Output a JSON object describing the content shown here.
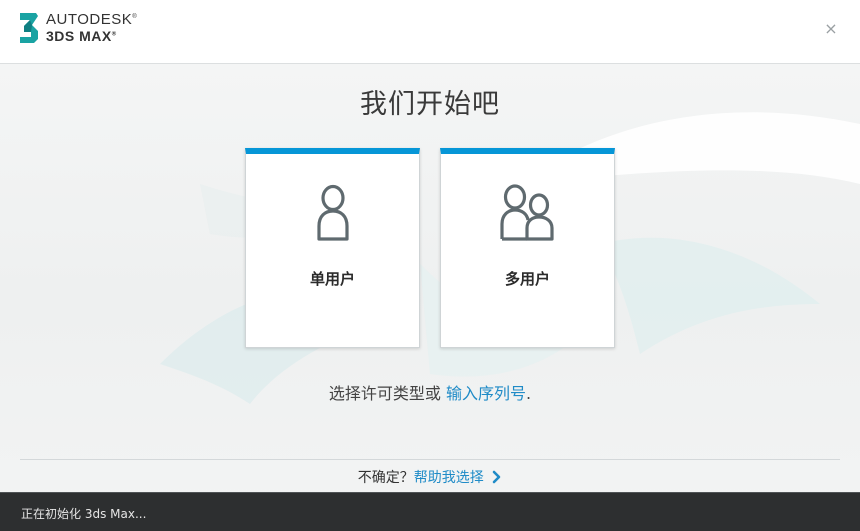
{
  "header": {
    "brand_line1": "AUTODESK",
    "brand_line2": "3DS MAX",
    "registered_mark": "®",
    "close_symbol": "×"
  },
  "main": {
    "title": "我们开始吧",
    "cards": [
      {
        "label": "单用户",
        "icon": "single-user-icon"
      },
      {
        "label": "多用户",
        "icon": "multi-user-icon"
      }
    ],
    "choose_text": "选择许可类型或",
    "serial_link": "输入序列号",
    "choose_suffix": "."
  },
  "footer": {
    "unsure_text": "不确定？",
    "help_link": "帮助我选择"
  },
  "status": {
    "text": "正在初始化 3ds Max..."
  },
  "colors": {
    "accent": "#0696d7",
    "link": "#1f8bc7",
    "logo_teal": "#1aa3a3",
    "status_bg": "#2d2f30"
  }
}
